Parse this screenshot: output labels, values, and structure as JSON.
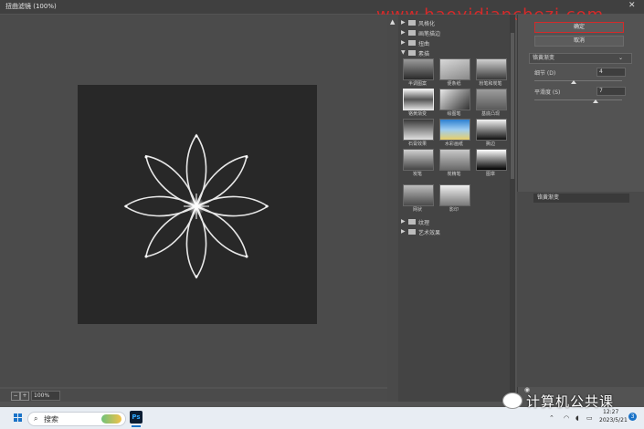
{
  "window": {
    "title": "扭曲滤镜 (100%)",
    "close_glyph": "✕"
  },
  "watermark": "www.haoyidianchezi.com",
  "zoom": {
    "value": "100%",
    "minus": "−",
    "plus": "+"
  },
  "gallery": {
    "categories_top": [
      {
        "label": "风格化",
        "expanded": false
      },
      {
        "label": "画笔描边",
        "expanded": false
      },
      {
        "label": "扭曲",
        "expanded": false
      },
      {
        "label": "素描",
        "expanded": true
      }
    ],
    "thumbnails": [
      {
        "label": "半调图案"
      },
      {
        "label": "便条纸"
      },
      {
        "label": "粉笔和炭笔"
      },
      {
        "label": "铬黄渐变"
      },
      {
        "label": "绘图笔"
      },
      {
        "label": "基底凸现"
      },
      {
        "label": "石膏效果"
      },
      {
        "label": "水彩画纸"
      },
      {
        "label": "撕边"
      },
      {
        "label": "炭笔"
      },
      {
        "label": "炭精笔"
      },
      {
        "label": "图章"
      },
      {
        "label": "网状"
      },
      {
        "label": "影印"
      }
    ],
    "categories_bottom": [
      {
        "label": "纹理",
        "expanded": false
      },
      {
        "label": "艺术效果",
        "expanded": false
      }
    ]
  },
  "settings": {
    "ok_label": "确定",
    "cancel_label": "取消",
    "filter_select": "铬黄渐变",
    "detail_label": "细节 (D)",
    "detail_value": "4",
    "detail_level": 0.45,
    "smooth_label": "平滑度 (S)",
    "smooth_value": "7",
    "smooth_level": 0.7,
    "layer_label": "铬黄渐变"
  },
  "taskbar": {
    "search_placeholder": "搜索",
    "ps_label": "Ps",
    "time": "12:27",
    "date": "2023/5/21",
    "notification_count": "3"
  },
  "overlay_tag": "计算机公共课"
}
